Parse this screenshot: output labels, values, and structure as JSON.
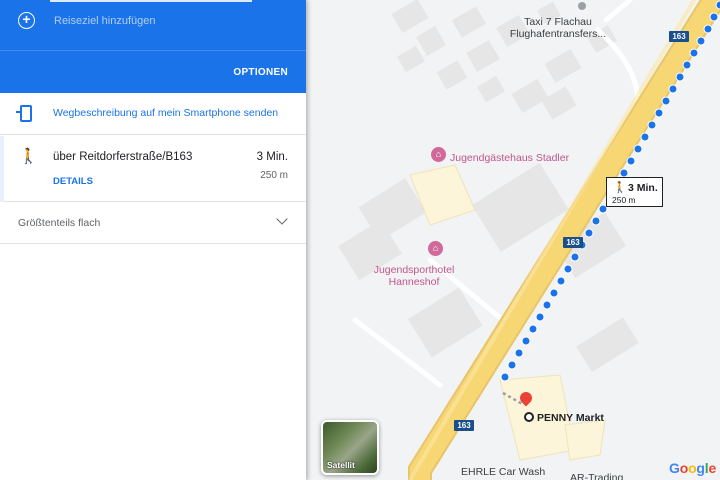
{
  "header": {
    "add_destination_label": "Reiseziel hinzufügen",
    "options_label": "OPTIONEN",
    "color": "#1a73e8"
  },
  "send_to_phone": {
    "label": "Wegbeschreibung auf mein Smartphone senden",
    "icon": "phone-send-icon"
  },
  "route": {
    "mode_icon": "walk-icon",
    "via": "über Reitdorferstraße/B163",
    "duration": "3 Min.",
    "details_label": "DETAILS",
    "distance": "250 m"
  },
  "terrain": {
    "label": "Größtenteils flach",
    "icon": "chevron-down-icon"
  },
  "map": {
    "labels": {
      "taxi_line1": "Taxi 7 Flachau",
      "taxi_line2": "Flughafentransfers...",
      "hostel": "Jugendgästehaus Stadler",
      "hotel_line1": "Jugendsporthotel",
      "hotel_line2": "Hanneshof",
      "destination": "PENNY Markt",
      "car_wash": "EHRLE Car Wash",
      "ar_trading": "AR-Trading"
    },
    "road_shield": "163",
    "walk_box": {
      "duration": "3 Min.",
      "distance": "250 m"
    },
    "satellite_label": "Satellit",
    "logo": "Google",
    "route_color": "#1a73e8",
    "road_color": "#f7d774",
    "destination_pin_color": "#ea4335"
  }
}
